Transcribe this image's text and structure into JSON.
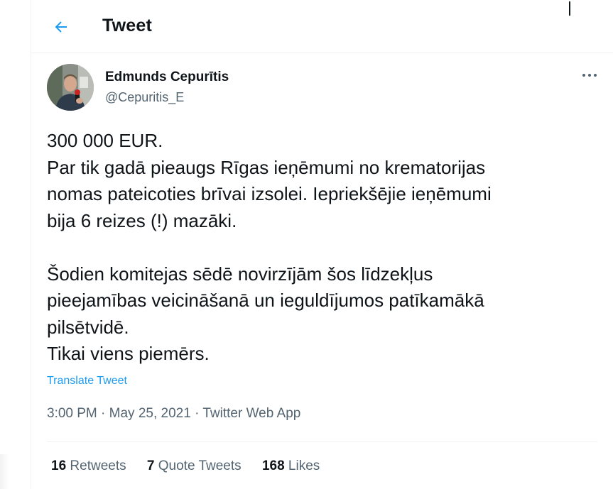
{
  "header": {
    "back_icon": "arrow-left-icon",
    "title": "Tweet"
  },
  "author": {
    "name": "Edmunds Cepurītis",
    "handle": "@Cepuritis_E",
    "avatar_icon": "profile-photo",
    "more_icon": "more-horizontal-icon"
  },
  "tweet": {
    "lines_p1": [
      "300 000 EUR.",
      "Par tik gadā pieaugs Rīgas ieņēmumi no krematorijas",
      "nomas pateicoties brīvai izsolei. Iepriekšējie ieņēmumi",
      "bija 6 reizes (!) mazāki."
    ],
    "lines_p2": [
      "Šodien komitejas sēdē novirzījām šos līdzekļus",
      "pieejamības veicināšanā un ieguldījumos patīkamākā",
      "pilsētvidē.",
      "Tikai viens piemērs."
    ],
    "translate_label": "Translate Tweet"
  },
  "meta": {
    "time": "3:00 PM",
    "separator": " · ",
    "date": "May 25, 2021",
    "source": "Twitter Web App"
  },
  "stats": {
    "retweets_count": "16",
    "retweets_label": "Retweets",
    "quote_count": "7",
    "quote_label": "Quote Tweets",
    "likes_count": "168",
    "likes_label": "Likes"
  },
  "colors": {
    "accent": "#1d9bf0",
    "text_primary": "#0f1419",
    "text_secondary": "#536471",
    "divider": "#eff3f4"
  }
}
